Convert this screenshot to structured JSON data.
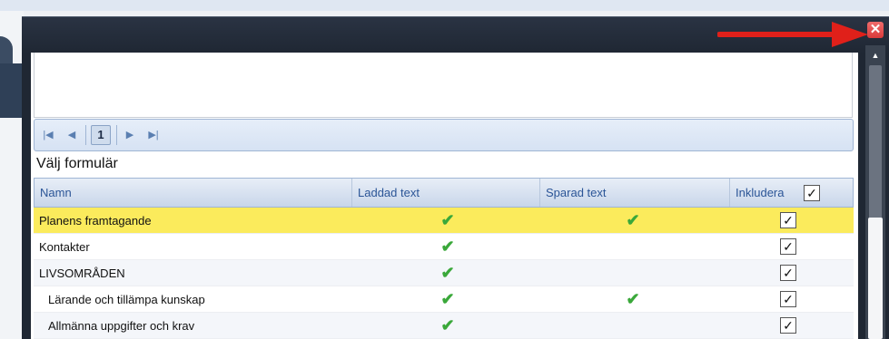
{
  "dialog": {
    "close_glyph": "✕",
    "scroll_up_glyph": "▲"
  },
  "pager": {
    "first_glyph": "|◀",
    "prev_glyph": "◀",
    "current_page": "1",
    "next_glyph": "▶",
    "last_glyph": "▶|"
  },
  "section_title": "Välj formulär",
  "table": {
    "columns": [
      "Namn",
      "Laddad text",
      "Sparad text",
      "Inkludera"
    ],
    "header_include_checked": "✓",
    "rows": [
      {
        "name": "Planens framtagande",
        "laddad": "✔",
        "sparad": "✔",
        "inkludera": "✓"
      },
      {
        "name": "Kontakter",
        "laddad": "✔",
        "sparad": "",
        "inkludera": "✓"
      },
      {
        "name": "LIVSOMRÅDEN",
        "laddad": "✔",
        "sparad": "",
        "inkludera": "✓"
      },
      {
        "name": "Lärande och tillämpa kunskap",
        "laddad": "✔",
        "sparad": "✔",
        "inkludera": "✓"
      },
      {
        "name": "Allmänna uppgifter och krav",
        "laddad": "✔",
        "sparad": "",
        "inkludera": "✓"
      }
    ]
  },
  "colors": {
    "highlight_row": "#fbeb5c",
    "check_green": "#3aa83a",
    "close_red": "#d93a3a",
    "annotation_arrow": "#e0201a",
    "header_text": "#2b5597"
  },
  "icons": [
    "close-icon",
    "chevron-up-icon",
    "first-page-icon",
    "prev-page-icon",
    "next-page-icon",
    "last-page-icon",
    "checkmark-icon",
    "red-arrow-annotation"
  ]
}
